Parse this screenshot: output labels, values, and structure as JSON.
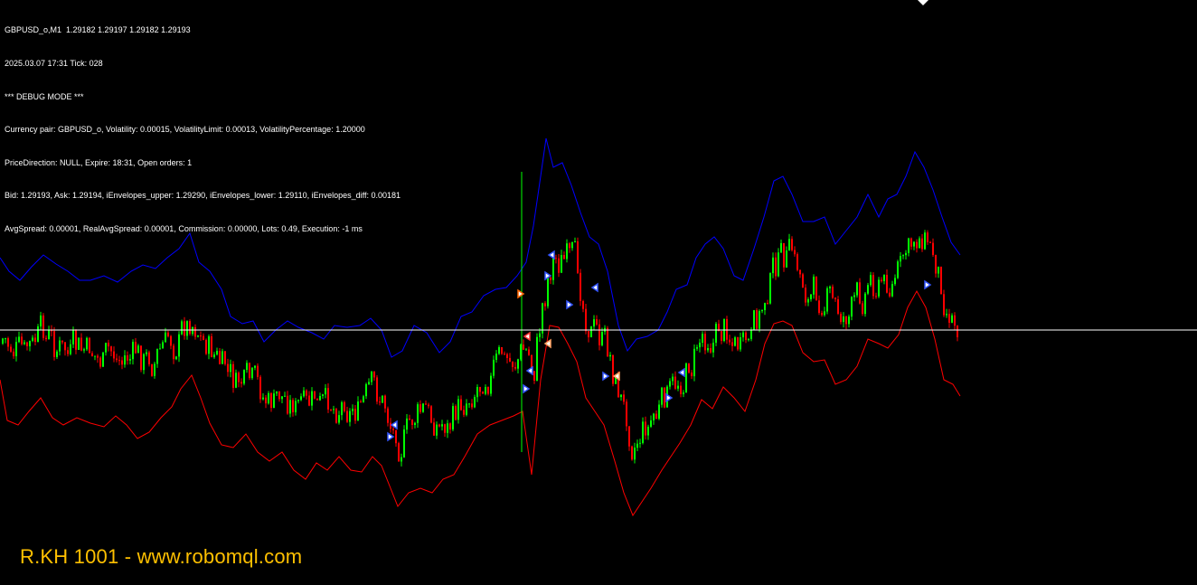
{
  "header": {
    "symbol_line": "GBPUSD_o,M1  1.29182 1.29197 1.29182 1.29193",
    "time_line": "2025.03.07 17:31 Tick: 028",
    "debug_line": "*** DEBUG MODE ***",
    "pair_line": "Currency pair: GBPUSD_o, Volatility: 0.00015, VolatilityLimit: 0.00013, VolatilityPercentage: 1.20000",
    "direction_line": "PriceDirection: NULL, Expire: 18:31, Open orders: 1",
    "bid_line": "Bid: 1.29193, Ask: 1.29194, iEnvelopes_upper: 1.29290, iEnvelopes_lower: 1.29110, iEnvelopes_diff: 0.00181",
    "spread_line": "AvgSpread: 0.00001, RealAvgSpread: 0.00001, Commission: 0.00000, Lots: 0.49, Execution: -1 ms"
  },
  "watermark": "R.KH 1001 - www.robomql.com",
  "colors": {
    "background": "#000000",
    "bull_candle": "#00ff00",
    "bear_candle": "#ff0000",
    "upper_envelope": "#0000ff",
    "lower_envelope": "#ff0000",
    "bid_line": "#ffffff",
    "text": "#ffffff",
    "watermark": "#ffc000"
  },
  "chart_data": {
    "type": "candlestick",
    "symbol": "GBPUSD_o",
    "timeframe": "M1",
    "current_bid": 1.29193,
    "envelope_upper": 1.2929,
    "envelope_lower": 1.2911,
    "icons": [
      "buy-arrow-icon",
      "sell-arrow-icon",
      "order-close-icon"
    ]
  }
}
